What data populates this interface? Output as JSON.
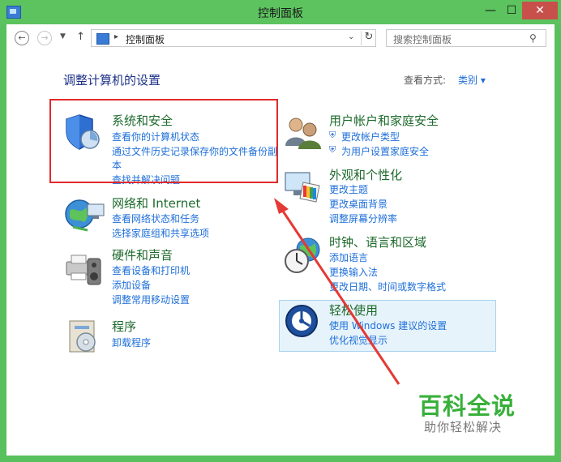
{
  "window": {
    "title": "控制面板"
  },
  "nav": {
    "address": "控制面板",
    "search_placeholder": "搜索控制面板"
  },
  "main": {
    "heading": "调整计算机的设置",
    "view_by_label": "查看方式:",
    "view_by_value": "类别 ▾"
  },
  "categories": {
    "system": {
      "title": "系统和安全",
      "links": [
        "查看你的计算机状态",
        "通过文件历史记录保存你的文件备份副",
        "本",
        "查找并解决问题"
      ]
    },
    "network": {
      "title": "网络和 Internet",
      "links": [
        "查看网络状态和任务",
        "选择家庭组和共享选项"
      ]
    },
    "hardware": {
      "title": "硬件和声音",
      "links": [
        "查看设备和打印机",
        "添加设备",
        "调整常用移动设置"
      ]
    },
    "programs": {
      "title": "程序",
      "links": [
        "卸载程序"
      ]
    },
    "users": {
      "title": "用户帐户和家庭安全",
      "links": [
        "更改帐户类型",
        "为用户设置家庭安全"
      ]
    },
    "appearance": {
      "title": "外观和个性化",
      "links": [
        "更改主题",
        "更改桌面背景",
        "调整屏幕分辨率"
      ]
    },
    "clock": {
      "title": "时钟、语言和区域",
      "links": [
        "添加语言",
        "更换输入法",
        "更改日期、时间或数字格式"
      ]
    },
    "ease": {
      "title": "轻松使用",
      "links": [
        "使用 Windows 建议的设置",
        "优化视觉显示"
      ]
    }
  },
  "watermark": {
    "title": "百科全说",
    "subtitle": "助你轻松解决"
  },
  "colors": {
    "titlebar": "#5cc35f",
    "link": "#1e6fd9",
    "category_title": "#1e6a2c",
    "highlight": "#e12a2a",
    "watermark": "#39b03b"
  }
}
